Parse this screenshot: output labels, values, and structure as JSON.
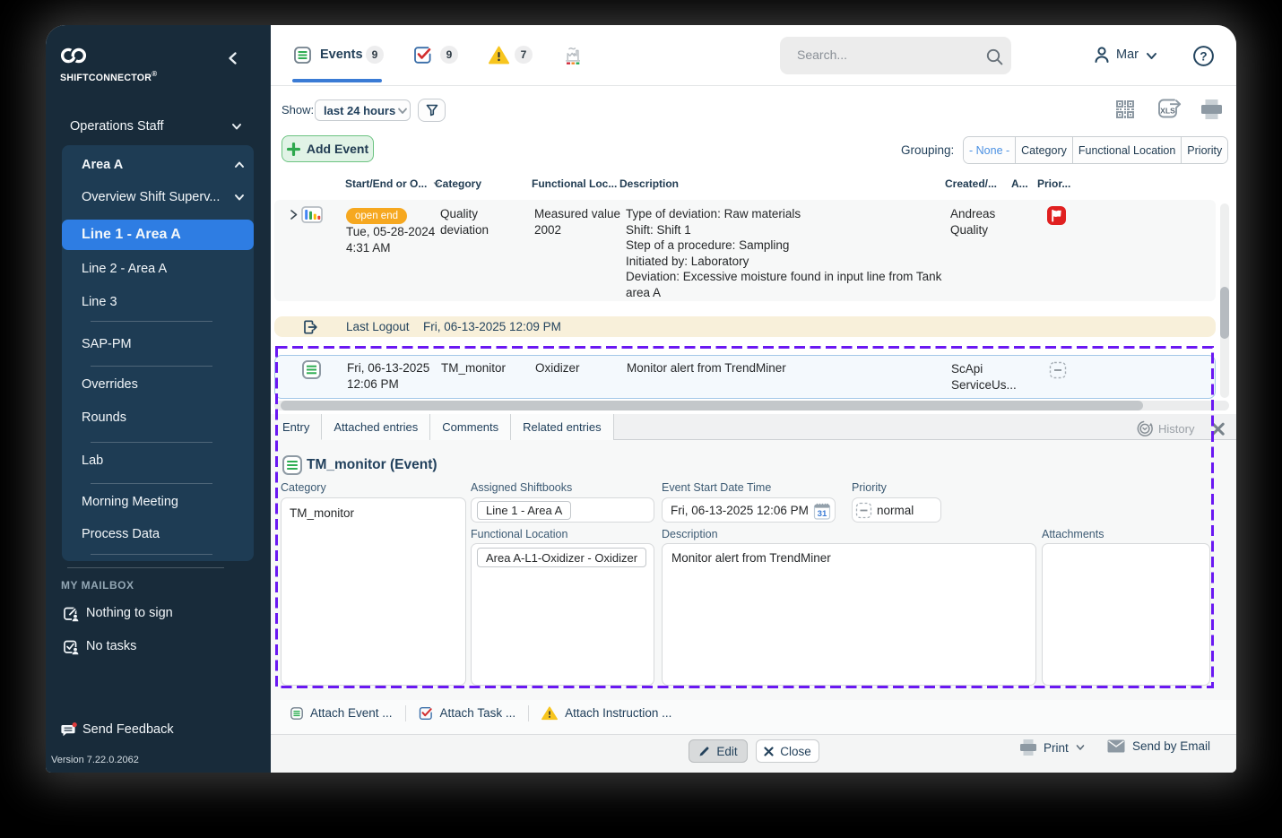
{
  "sidebar": {
    "brand": "SHIFTCONNECTOR",
    "brand_reg": "®",
    "top_item": "Operations Staff",
    "area_panel": {
      "header": "Area A",
      "overview": "Overview Shift Superv...",
      "line1": "Line 1 - Area A",
      "line2": "Line 2 - Area A",
      "line3": "Line 3",
      "sap": "SAP-PM",
      "overrides": "Overrides",
      "rounds": "Rounds",
      "lab": "Lab",
      "morning": "Morning Meeting",
      "process": "Process Data"
    },
    "mailbox_heading": "MY MAILBOX",
    "nothing_to_sign": "Nothing to sign",
    "no_tasks": "No tasks",
    "send_feedback": "Send Feedback",
    "version": "Version 7.22.0.2062"
  },
  "topbar": {
    "events_tab": {
      "label": "Events",
      "badge": "9"
    },
    "tasks_badge": "9",
    "instructions_badge": "7",
    "search_placeholder": "Search...",
    "user": "Mar"
  },
  "toolbar": {
    "show_label": "Show:",
    "range_value": "last 24 hours"
  },
  "actions": {
    "add_event": "Add Event",
    "grouping_label": "Grouping:",
    "grouping_options": [
      "- None -",
      "Category",
      "Functional Location",
      "Priority"
    ]
  },
  "table": {
    "columns": [
      "Start/End or O...",
      "Category",
      "Functional Loc...",
      "Description",
      "Created/...",
      "A...",
      "Prior..."
    ],
    "row1": {
      "badge": "open end",
      "date_line1": "Tue, 05-28-2024",
      "date_line2": "4:31 AM",
      "category_line1": "Quality",
      "category_line2": "deviation",
      "functional_location": "Measured value 2002",
      "description_lines": [
        "Type of deviation: Raw materials",
        "Shift: Shift 1",
        "Step of a procedure: Sampling",
        "Initiated by: Laboratory",
        "Deviation: Excessive moisture found in input line from Tank area A"
      ],
      "created_line1": "Andreas",
      "created_line2": "Quality"
    },
    "row2": {
      "label": "Last Logout",
      "timestamp": "Fri, 06-13-2025 12:09 PM"
    },
    "row3": {
      "date_line1": "Fri, 06-13-2025",
      "date_line2": "12:06 PM",
      "category": "TM_monitor",
      "functional_location": "Oxidizer",
      "description": "Monitor alert from TrendMiner",
      "created_line1": "ScApi",
      "created_line2": "ServiceUs..."
    }
  },
  "detail": {
    "tabs": [
      "Entry",
      "Attached entries",
      "Comments",
      "Related entries"
    ],
    "history": "History",
    "title": "TM_monitor (Event)",
    "fields": {
      "category": {
        "label": "Category",
        "value": "TM_monitor"
      },
      "assigned_shiftbooks": {
        "label": "Assigned Shiftbooks",
        "value": "Line 1 - Area A"
      },
      "event_start": {
        "label": "Event Start Date Time",
        "value": "Fri, 06-13-2025 12:06 PM",
        "calendar_day": "31"
      },
      "priority": {
        "label": "Priority",
        "value": "normal"
      },
      "functional_location": {
        "label": "Functional Location",
        "value": "Area A-L1-Oxidizer - Oxidizer"
      },
      "description": {
        "label": "Description",
        "value": "Monitor alert from TrendMiner"
      },
      "attachments": {
        "label": "Attachments"
      }
    },
    "attach_event": "Attach Event ...",
    "attach_task": "Attach Task ...",
    "attach_instruction": "Attach Instruction ...",
    "footer": {
      "edit": "Edit",
      "close": "Close",
      "print": "Print",
      "send_by_email": "Send by Email"
    }
  }
}
